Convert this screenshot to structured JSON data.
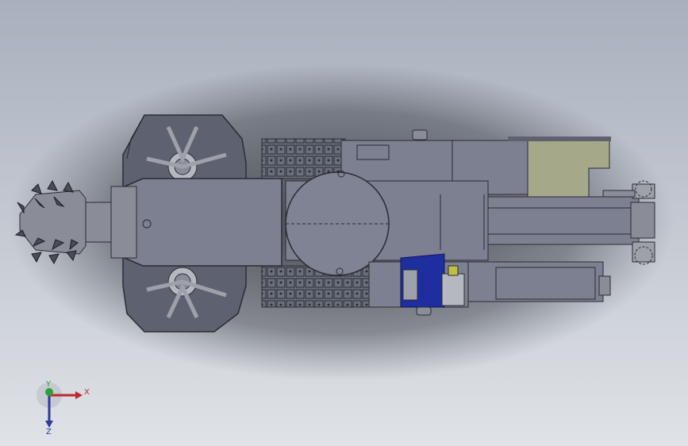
{
  "view": {
    "background_top": "#a9b0bd",
    "background_bottom": "#dfe2e6"
  },
  "model": {
    "name": "roadheader-top-view",
    "colors": {
      "body": "#7c8090",
      "body_dark": "#5e6270",
      "edge": "#2a2c33",
      "panel_khaki": "#a6a88a",
      "hydraulic_blue": "#1e2e9e",
      "track": "#6b6f7c",
      "cutter": "#8a8d97"
    }
  },
  "triad": {
    "x_label": "X",
    "y_label": "Y",
    "z_label": "Z",
    "x_color": "#c0282d",
    "y_color": "#2f9e3c",
    "z_color": "#2b3a9c"
  }
}
